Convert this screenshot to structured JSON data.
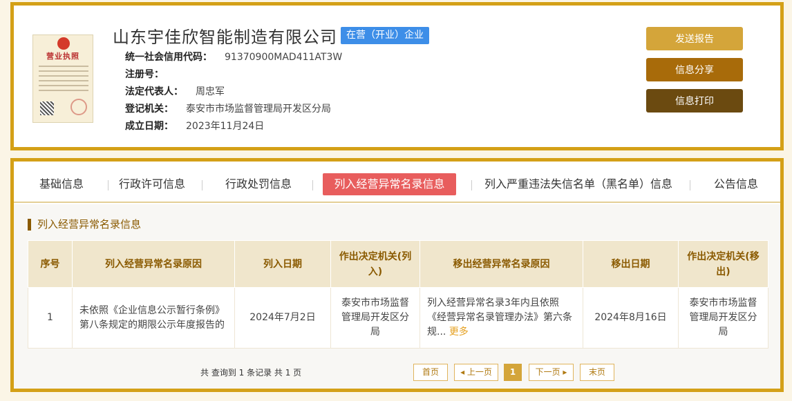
{
  "license": {
    "title": "营业执照"
  },
  "company": {
    "name": "山东宇佳欣智能制造有限公司",
    "status": "在营（开业）企业",
    "fields": [
      {
        "label": "统一社会信用代码：",
        "value": "91370900MAD411AT3W"
      },
      {
        "label": "注册号：",
        "value": ""
      },
      {
        "label": "法定代表人：",
        "value": "周忠军"
      },
      {
        "label": "登记机关：",
        "value": "泰安市市场监督管理局开发区分局"
      },
      {
        "label": "成立日期：",
        "value": "2023年11月24日"
      }
    ]
  },
  "actions": {
    "send": "发送报告",
    "share": "信息分享",
    "print": "信息打印"
  },
  "tabs": [
    "基础信息",
    "行政许可信息",
    "行政处罚信息",
    "列入经营异常名录信息",
    "列入严重违法失信名单（黑名单）信息",
    "公告信息"
  ],
  "section_title": "列入经营异常名录信息",
  "table": {
    "headers": [
      "序号",
      "列入经营异常名录原因",
      "列入日期",
      "作出决定机关(列入)",
      "移出经营异常名录原因",
      "移出日期",
      "作出决定机关(移出)"
    ],
    "rows": [
      {
        "no": "1",
        "reason": "未依照《企业信息公示暂行条例》第八条规定的期限公示年度报告的",
        "date_in": "2024年7月2日",
        "authority_in": "泰安市市场监督管理局开发区分局",
        "remove_reason": "列入经营异常名录3年内且依照《经营异常名录管理办法》第六条规...",
        "more": "更多",
        "date_out": "2024年8月16日",
        "authority_out": "泰安市市场监督管理局开发区分局"
      }
    ]
  },
  "pagination": {
    "summary": "共 查询到 1 条记录 共 1 页",
    "first": "首页",
    "prev": "上一页",
    "current": "1",
    "next": "下一页",
    "last": "末页"
  },
  "colors": {
    "gold": "#d4a017",
    "active_tab": "#e85d5d",
    "badge": "#3d8ee8",
    "header_text": "#8a5a00"
  }
}
